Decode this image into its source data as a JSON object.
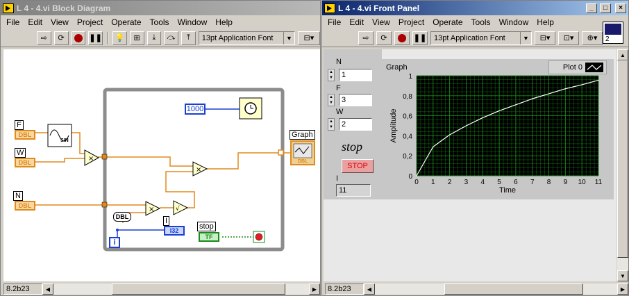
{
  "block_diagram": {
    "title": "L 4 - 4.vi Block Diagram",
    "menu": [
      "File",
      "Edit",
      "View",
      "Project",
      "Operate",
      "Tools",
      "Window",
      "Help"
    ],
    "font_selector": "13pt Application Font",
    "terminals": {
      "f_label": "F",
      "f_type": "DBL",
      "w_label": "W",
      "w_type": "DBL",
      "n_label": "N",
      "n_type": "DBL",
      "graph_label": "Graph",
      "graph_type": "DBL",
      "i_label": "I",
      "i_type": "I32",
      "stop_label": "stop",
      "stop_type": "TF",
      "loop_index": "i",
      "dbl_convert": "DBL",
      "wait_const": "1000",
      "sin_text": "SIN"
    },
    "version": "8.2b23"
  },
  "front_panel": {
    "title": "L 4 - 4.vi Front Panel",
    "menu": [
      "File",
      "Edit",
      "View",
      "Project",
      "Operate",
      "Tools",
      "Window",
      "Help"
    ],
    "font_selector": "13pt Application Font",
    "controls": {
      "n_label": "N",
      "n_value": "1",
      "f_label": "F",
      "f_value": "3",
      "w_label": "W",
      "w_value": "2",
      "stop_caption": "stop",
      "stop_button": "STOP",
      "i_label": "I",
      "i_value": "11"
    },
    "graph_label": "Graph",
    "plot_legend": "Plot 0",
    "version": "8.2b23",
    "icon_number": "2"
  },
  "chart_data": {
    "type": "line",
    "xlabel": "Time",
    "ylabel": "Amplitude",
    "xlim": [
      0,
      11
    ],
    "ylim": [
      0,
      1
    ],
    "xticks": [
      "0",
      "1",
      "2",
      "3",
      "4",
      "5",
      "6",
      "7",
      "8",
      "9",
      "10",
      "11"
    ],
    "yticks": [
      "0",
      "0,2",
      "0,4",
      "0,6",
      "0,8",
      "1"
    ],
    "x": [
      0,
      1,
      2,
      3,
      4,
      5,
      6,
      7,
      8,
      9,
      10,
      11
    ],
    "values": [
      0,
      0.29,
      0.41,
      0.5,
      0.58,
      0.65,
      0.71,
      0.77,
      0.82,
      0.87,
      0.91,
      0.955
    ],
    "grid": true,
    "colors": {
      "plot_bg": "#000000",
      "grid": "#1a8a1a",
      "line": "#ffffff"
    }
  }
}
